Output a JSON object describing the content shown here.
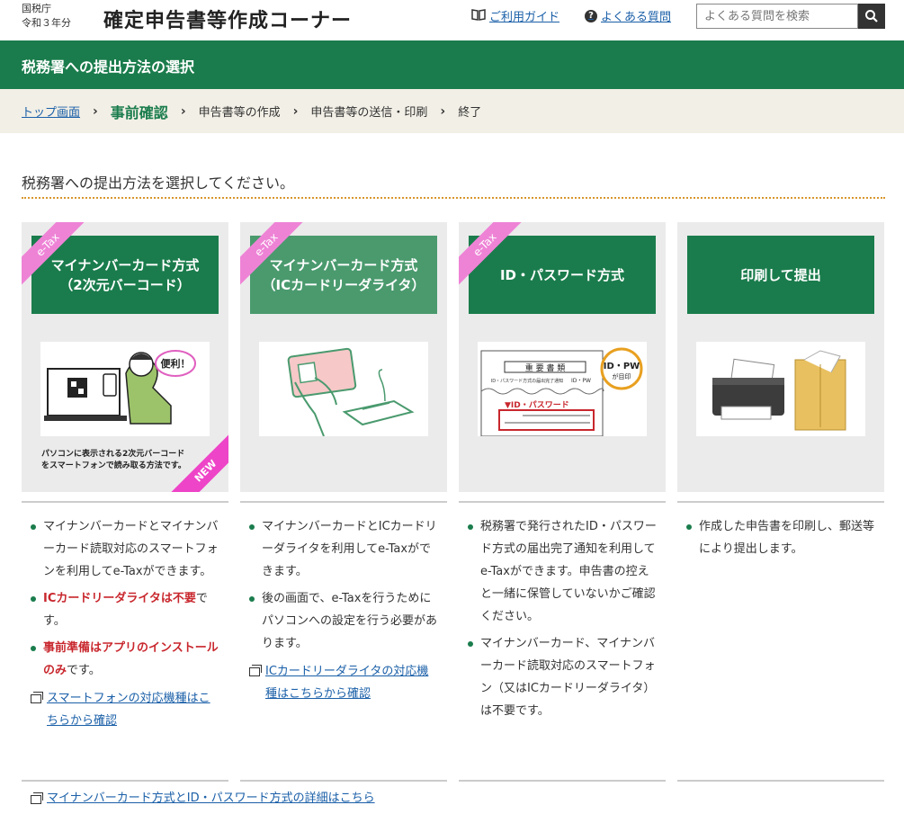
{
  "header": {
    "agency": "国税庁",
    "year": "令和３年分",
    "title": "確定申告書等作成コーナー",
    "guide_link": "ご利用ガイド",
    "faq_link": "よくある質問",
    "search_placeholder": "よくある質問を検索"
  },
  "page_bar": {
    "title": "税務署への提出方法の選択"
  },
  "breadcrumb": [
    {
      "label": "トップ画面"
    },
    {
      "label": "事前確認"
    },
    {
      "label": "申告書等の作成"
    },
    {
      "label": "申告書等の送信・印刷"
    },
    {
      "label": "終了"
    }
  ],
  "instruction": "税務署への提出方法を選択してください。",
  "etax_badge": "e-Tax",
  "cards": [
    {
      "title_line1": "マイナンバーカード方式",
      "title_line2": "（2次元バーコード）",
      "bubble": "便利！",
      "caption_line1": "パソコンに表示される2次元バーコード",
      "caption_line2": "をスマートフォンで読み取る方法です。",
      "new_badge": "NEW",
      "desc1": "マイナンバーカードとマイナンバーカード読取対応のスマートフォンを利用してe-Taxができます。",
      "desc2_red": "ICカードリーダライタは不要",
      "desc2_rest": "です。",
      "desc3_red": "事前準備はアプリのインストールのみ",
      "desc3_rest": "です。",
      "link": "スマートフォンの対応機種はこちらから確認"
    },
    {
      "title_line1": "マイナンバーカード方式",
      "title_line2": "（ICカードリーダライタ）",
      "desc1": "マイナンバーカードとICカードリーダライタを利用してe-Taxができます。",
      "desc2": "後の画面で、e-Taxを行うためにパソコンへの設定を行う必要があります。",
      "link": "ICカードリーダライタの対応機種はこちらから確認"
    },
    {
      "title_line1": "ID・パスワード方式",
      "doc_title": "重 要 書 類",
      "doc_sub": "ID・パスワード方式の届出完了通知",
      "doc_badge": "ID・PW",
      "doc_idpw_label": "▼ID・パスワード",
      "stamp_line1": "ID・PW",
      "stamp_line2": "が目印",
      "desc1": "税務署で発行されたID・パスワード方式の届出完了通知を利用してe-Taxができます。申告書の控えと一緒に保管していないかご確認ください。",
      "desc2": "マイナンバーカード、マイナンバーカード読取対応のスマートフォン（又はICカードリーダライタ）は不要です。"
    },
    {
      "title_line1": "印刷して提出",
      "desc1": "作成した申告書を印刷し、郵送等により提出します。"
    }
  ],
  "footer_link": "マイナンバーカード方式とID・パスワード方式の詳細はこちら",
  "colors": {
    "green": "#1a7c4c",
    "light_green": "#4a9a6e",
    "pink": "#ee83d6",
    "red": "#c8272d",
    "link": "#1a5fa8"
  }
}
